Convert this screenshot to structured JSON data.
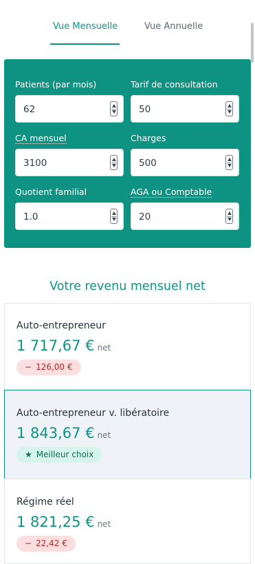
{
  "tabs": {
    "monthly": "Vue Mensuelle",
    "yearly": "Vue Annuelle",
    "active": "monthly"
  },
  "form": {
    "patients": {
      "label": "Patients (par mois)",
      "value": "62"
    },
    "tarif": {
      "label": "Tarif de consultation",
      "value": "50"
    },
    "ca": {
      "label": "CA mensuel",
      "value": "3100"
    },
    "charges": {
      "label": "Charges",
      "value": "500"
    },
    "quotient": {
      "label": "Quotient familial",
      "value": "1.0"
    },
    "aga": {
      "label": "AGA ou Comptable",
      "value": "20"
    }
  },
  "results": {
    "title": "Votre revenu mensuel net",
    "net_label": "net",
    "cards": [
      {
        "name": "Auto-entrepreneur",
        "amount": "1 717,67 €",
        "badge_symbol": "−",
        "badge_text": "126,00 €"
      },
      {
        "name": "Auto-entrepreneur v. libératoire",
        "amount": "1 843,67 €",
        "badge_symbol": "★",
        "badge_text": "Meilleur choix"
      },
      {
        "name": "Régime réel",
        "amount": "1 821,25 €",
        "badge_symbol": "−",
        "badge_text": "22,42 €"
      }
    ]
  },
  "colors": {
    "accent": "#0e9383",
    "negative_badge_bg": "#fbdede",
    "negative_badge_text": "#b0262b",
    "best_badge_bg": "#d6f5ea",
    "best_card_bg": "#eff3f7"
  }
}
